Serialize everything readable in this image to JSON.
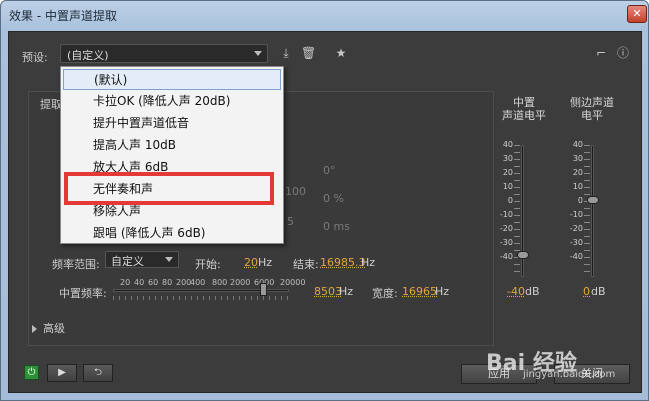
{
  "window": {
    "title": "效果 - 中置声道提取",
    "close_glyph": "✕"
  },
  "header": {
    "preset_label": "预设:",
    "preset_value": "(自定义)",
    "icons": [
      "save-preset-icon",
      "delete-preset-icon",
      "favorite-star-icon",
      "routing-icon",
      "info-icon"
    ]
  },
  "dropdown": {
    "items": [
      {
        "label": "(默认)"
      },
      {
        "label": "卡拉OK (降低人声 20dB)"
      },
      {
        "label": "提升中置声道低音"
      },
      {
        "label": "提高人声 10dB"
      },
      {
        "label": "放大人声 6dB"
      },
      {
        "label": "无伴奏和声"
      },
      {
        "label": "移除人声"
      },
      {
        "label": "跟唱 (降低人声 6dB)"
      }
    ],
    "selected_index": 0,
    "highlighted_item": "无伴奏和声"
  },
  "main": {
    "tab_hint": "提取",
    "obscured": {
      "a": "0°",
      "b": "0 %",
      "c": "0 ms",
      "d": "100",
      "e": "5"
    },
    "freq_range_label": "频率范围:",
    "freq_range_value": "自定义",
    "start_label": "开始:",
    "start_value": "20",
    "start_unit": "Hz",
    "end_label": "结束:",
    "end_value": "16985.3",
    "end_unit": "Hz",
    "center_freq_label": "中置频率:",
    "center_freq_value": "8503",
    "center_freq_unit": "Hz",
    "width_label": "宽度:",
    "width_value": "16965",
    "width_unit": "Hz",
    "scale_ticks": [
      "20",
      "40",
      "60",
      "80",
      "200",
      "400",
      "800",
      "2000",
      "6000",
      "20000"
    ]
  },
  "meters": {
    "center": {
      "title_line1": "中置",
      "title_line2": "声道电平",
      "value": "-40",
      "unit": "dB"
    },
    "side": {
      "title_line1": "侧边声道",
      "title_line2": "电平",
      "value": "0",
      "unit": "dB"
    },
    "scale": [
      "40",
      "30",
      "20",
      "10",
      "0",
      "-10",
      "-20",
      "-30",
      "-40"
    ]
  },
  "advanced_label": "高级",
  "footer": {
    "apply": "应用",
    "close": "关闭",
    "power_glyph": "⏻",
    "play_glyph": "▶",
    "loop_glyph": "⮌"
  },
  "watermark": {
    "brand": "Bai 经验",
    "url": "jingyan.baidu.com"
  }
}
